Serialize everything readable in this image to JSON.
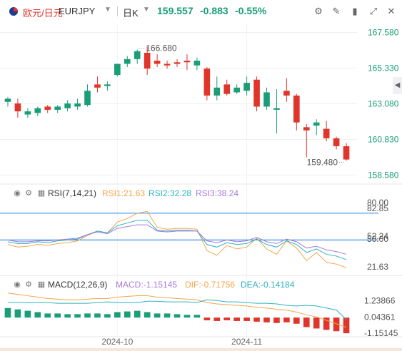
{
  "header": {
    "pair_cn": "欧元/日元",
    "pair_code": "EURJPY",
    "period": "日K",
    "price": "159.557",
    "change": "-0.883",
    "change_pct": "-0.55%",
    "icons": [
      "flag-icon",
      "chevron-down-icon",
      "settings-icon",
      "draw-icon",
      "candle-type-icon",
      "expand-icon",
      "close-icon"
    ]
  },
  "colors": {
    "up": "#1a9e77",
    "down": "#e0352b",
    "pair_cn": "#e0352b",
    "axis": "#1a9e77",
    "rsi1": "#f5a54a",
    "rsi2": "#2bb3c0",
    "rsi3": "#a87bd8",
    "rsi_line": "#3f8fe8",
    "macd_dif": "#f5a54a",
    "macd_dea": "#2bb3c0"
  },
  "chart_data": [
    {
      "type": "candlestick",
      "y_ticks": [
        "167.580",
        "165.330",
        "163.080",
        "160.830",
        "158.580"
      ],
      "ylim": [
        158.1,
        168.1
      ],
      "x_ticks": [
        "2024-10",
        "2024-11"
      ],
      "x_tick_index": [
        11,
        24
      ],
      "max_annotation": "166.680",
      "min_annotation": "159.480",
      "max_index": 13,
      "min_index": 34,
      "candles": [
        {
          "o": 163.2,
          "h": 163.5,
          "l": 162.9,
          "c": 163.4
        },
        {
          "o": 163.1,
          "h": 163.4,
          "l": 162.2,
          "c": 162.6
        },
        {
          "o": 162.4,
          "h": 162.8,
          "l": 162.2,
          "c": 162.6
        },
        {
          "o": 162.5,
          "h": 162.9,
          "l": 162.3,
          "c": 162.8
        },
        {
          "o": 162.9,
          "h": 163.0,
          "l": 162.5,
          "c": 162.7
        },
        {
          "o": 162.7,
          "h": 163.0,
          "l": 162.5,
          "c": 162.9
        },
        {
          "o": 162.8,
          "h": 163.3,
          "l": 162.6,
          "c": 163.1
        },
        {
          "o": 162.9,
          "h": 163.4,
          "l": 162.7,
          "c": 163.1
        },
        {
          "o": 163.0,
          "h": 164.3,
          "l": 162.9,
          "c": 163.9
        },
        {
          "o": 164.3,
          "h": 164.8,
          "l": 163.8,
          "c": 164.1
        },
        {
          "o": 164.2,
          "h": 164.5,
          "l": 163.9,
          "c": 164.3
        },
        {
          "o": 164.9,
          "h": 165.6,
          "l": 164.8,
          "c": 165.6
        },
        {
          "o": 165.6,
          "h": 166.1,
          "l": 165.4,
          "c": 165.9
        },
        {
          "o": 165.9,
          "h": 166.5,
          "l": 165.6,
          "c": 166.4
        },
        {
          "o": 166.3,
          "h": 166.68,
          "l": 164.9,
          "c": 165.3
        },
        {
          "o": 165.8,
          "h": 166.2,
          "l": 165.4,
          "c": 165.6
        },
        {
          "o": 165.6,
          "h": 165.8,
          "l": 165.3,
          "c": 165.5
        },
        {
          "o": 165.7,
          "h": 165.9,
          "l": 165.4,
          "c": 165.6
        },
        {
          "o": 165.8,
          "h": 166.2,
          "l": 165.2,
          "c": 165.7
        },
        {
          "o": 165.5,
          "h": 166.0,
          "l": 165.2,
          "c": 165.8
        },
        {
          "o": 165.3,
          "h": 165.4,
          "l": 163.3,
          "c": 163.6
        },
        {
          "o": 163.6,
          "h": 164.8,
          "l": 163.3,
          "c": 164.1
        },
        {
          "o": 164.3,
          "h": 164.6,
          "l": 163.6,
          "c": 163.7
        },
        {
          "o": 163.8,
          "h": 164.3,
          "l": 163.7,
          "c": 164.1
        },
        {
          "o": 163.9,
          "h": 164.8,
          "l": 163.6,
          "c": 164.4
        },
        {
          "o": 164.6,
          "h": 164.8,
          "l": 162.6,
          "c": 162.9
        },
        {
          "o": 162.9,
          "h": 164.1,
          "l": 162.7,
          "c": 163.8
        },
        {
          "o": 162.7,
          "h": 164.0,
          "l": 161.2,
          "c": 162.8
        },
        {
          "o": 163.9,
          "h": 164.7,
          "l": 163.2,
          "c": 163.6
        },
        {
          "o": 163.6,
          "h": 163.7,
          "l": 161.4,
          "c": 161.9
        },
        {
          "o": 161.6,
          "h": 161.8,
          "l": 159.7,
          "c": 161.4
        },
        {
          "o": 161.7,
          "h": 162.1,
          "l": 161.1,
          "c": 161.9
        },
        {
          "o": 161.5,
          "h": 162.0,
          "l": 160.7,
          "c": 160.9
        },
        {
          "o": 160.9,
          "h": 161.0,
          "l": 160.2,
          "c": 160.4
        },
        {
          "o": 160.4,
          "h": 160.6,
          "l": 159.48,
          "c": 159.56
        }
      ]
    },
    {
      "type": "line",
      "label": "RSI(7,14,21)",
      "rsi1_label": "RSI1:21.63",
      "rsi2_label": "RSI2:32.28",
      "rsi3_label": "RSI3:38.24",
      "y_ticks": [
        "80.00",
        "82.85",
        "52.24",
        "50.00",
        "21.63"
      ],
      "ylim": [
        12,
        95
      ],
      "ref_lines": [
        80,
        50
      ],
      "series": [
        {
          "name": "RSI1",
          "values": [
            45,
            42,
            43,
            45,
            44,
            46,
            47,
            49,
            55,
            60,
            58,
            70,
            74,
            80,
            82,
            64,
            62,
            63,
            63,
            62,
            38,
            33,
            44,
            40,
            42,
            52,
            40,
            34,
            49,
            41,
            27,
            36,
            25,
            23,
            19
          ]
        },
        {
          "name": "RSI2",
          "values": [
            48,
            46,
            46,
            48,
            47,
            49,
            50,
            51,
            56,
            60,
            58,
            66,
            69,
            72,
            72,
            61,
            60,
            61,
            61,
            60,
            45,
            42,
            47,
            45,
            46,
            51,
            45,
            42,
            49,
            45,
            36,
            40,
            34,
            32,
            28
          ]
        },
        {
          "name": "RSI3",
          "values": [
            50,
            48,
            48,
            49,
            49,
            50,
            51,
            52,
            56,
            59,
            57,
            63,
            65,
            67,
            67,
            60,
            59,
            60,
            60,
            60,
            49,
            47,
            50,
            48,
            49,
            53,
            48,
            46,
            51,
            48,
            41,
            43,
            39,
            37,
            34
          ]
        }
      ]
    },
    {
      "type": "bar+line",
      "label": "MACD(12,26,9)",
      "macd_label": "MACD:-1.15145",
      "dif_label": "DIF:-0.71756",
      "dea_label": "DEA:-0.14184",
      "y_ticks": [
        "1.23866",
        "0.04361",
        "-1.15145"
      ],
      "y_tick_values": [
        1.23866,
        0.04361,
        -1.15145
      ],
      "ylim": [
        -1.3,
        2.1
      ],
      "histogram": [
        0.7,
        0.6,
        0.5,
        0.4,
        0.3,
        0.3,
        0.25,
        0.25,
        0.3,
        0.3,
        0.25,
        0.4,
        0.45,
        0.5,
        0.4,
        0.3,
        0.3,
        0.25,
        0.2,
        0.2,
        -0.2,
        -0.25,
        -0.2,
        -0.25,
        -0.25,
        -0.3,
        -0.35,
        -0.4,
        -0.35,
        -0.45,
        -0.7,
        -0.8,
        -0.9,
        -1.0,
        -1.15145
      ],
      "series": [
        {
          "name": "DIF",
          "values": [
            1.8,
            1.7,
            1.6,
            1.5,
            1.4,
            1.35,
            1.3,
            1.3,
            1.35,
            1.4,
            1.4,
            1.5,
            1.55,
            1.6,
            1.6,
            1.5,
            1.45,
            1.4,
            1.35,
            1.3,
            1.1,
            1.0,
            0.95,
            0.9,
            0.85,
            0.75,
            0.7,
            0.6,
            0.55,
            0.4,
            0.2,
            0.05,
            -0.2,
            -0.45,
            -0.71756
          ]
        },
        {
          "name": "DEA",
          "values": [
            1.1,
            1.1,
            1.1,
            1.1,
            1.1,
            1.05,
            1.05,
            1.05,
            1.05,
            1.1,
            1.15,
            1.1,
            1.1,
            1.1,
            1.2,
            1.2,
            1.15,
            1.15,
            1.15,
            1.1,
            1.3,
            1.25,
            1.15,
            1.15,
            1.1,
            1.05,
            1.05,
            1.0,
            0.9,
            0.85,
            0.9,
            0.85,
            0.7,
            0.55,
            -0.14184
          ]
        }
      ]
    }
  ]
}
